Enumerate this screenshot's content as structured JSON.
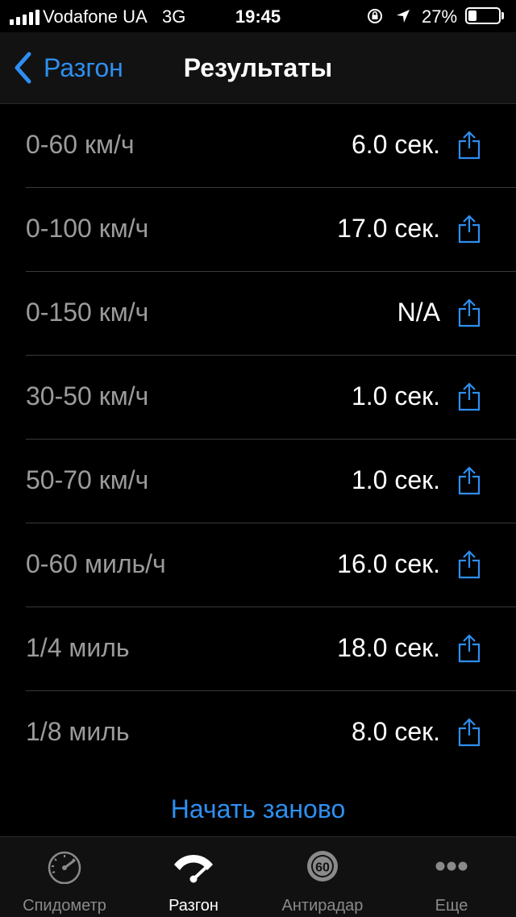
{
  "status_bar": {
    "carrier": "Vodafone UA",
    "network": "3G",
    "time": "19:45",
    "battery_percent": "27%",
    "battery_level": 0.27
  },
  "nav": {
    "back_label": "Разгон",
    "title": "Результаты"
  },
  "results": [
    {
      "label": "0-60 км/ч",
      "value": "6.0 сек."
    },
    {
      "label": "0-100 км/ч",
      "value": "17.0 сек."
    },
    {
      "label": "0-150 км/ч",
      "value": "N/A"
    },
    {
      "label": "30-50 км/ч",
      "value": "1.0 сек."
    },
    {
      "label": "50-70 км/ч",
      "value": "1.0 сек."
    },
    {
      "label": "0-60 миль/ч",
      "value": "16.0 сек."
    },
    {
      "label": "1/4 миль",
      "value": "18.0 сек."
    },
    {
      "label": "1/8 миль",
      "value": "8.0 сек."
    }
  ],
  "restart_label": "Начать заново",
  "tabs": [
    {
      "label": "Спидометр",
      "icon": "speedometer-icon",
      "active": false
    },
    {
      "label": "Разгон",
      "icon": "acceleration-icon",
      "active": true
    },
    {
      "label": "Антирадар",
      "icon": "speed-limit-icon",
      "active": false,
      "badge": "60"
    },
    {
      "label": "Еще",
      "icon": "more-icon",
      "active": false
    }
  ],
  "colors": {
    "accent": "#2e8ff0",
    "background": "#000000",
    "label": "#9b9b9b",
    "inactive_tab": "#8a8a8a"
  }
}
